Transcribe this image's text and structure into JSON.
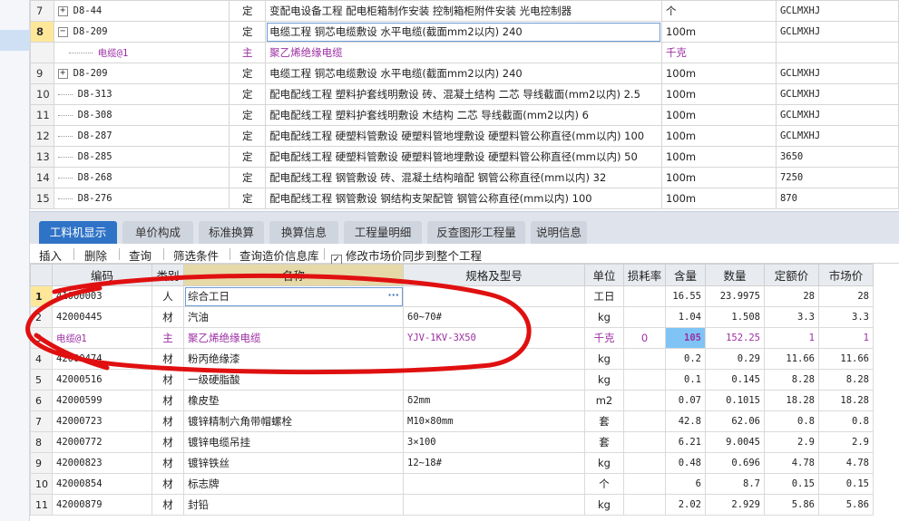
{
  "upper_rows": [
    {
      "rn": "7",
      "code": "D8-44",
      "expand": "+",
      "type": "定",
      "name": "变配电设备工程 配电柜箱制作安装 控制箱柜附件安装 光电控制器",
      "unit": "个",
      "spec": "",
      "extra": "GCLMXHJ"
    },
    {
      "rn": "8",
      "code": "D8-209",
      "expand": "−",
      "type": "定",
      "name": "电缆工程 铜芯电缆敷设 水平电缆(截面mm2以内) 240",
      "unit": "100m",
      "spec": "",
      "extra": "GCLMXHJ"
    },
    {
      "rn": "",
      "code": "电缆@1",
      "expand": "",
      "type": "主",
      "name": "聚乙烯绝缘电缆",
      "unit": "千克",
      "spec": "",
      "extra": ""
    },
    {
      "rn": "9",
      "code": "D8-209",
      "expand": "+",
      "type": "定",
      "name": "电缆工程 铜芯电缆敷设 水平电缆(截面mm2以内) 240",
      "unit": "100m",
      "spec": "",
      "extra": "GCLMXHJ"
    },
    {
      "rn": "10",
      "code": "D8-313",
      "expand": "",
      "type": "定",
      "name": "配电配线工程 塑料护套线明敷设 砖、混凝土结构 二芯 导线截面(mm2以内) 2.5",
      "unit": "100m",
      "spec": "",
      "extra": "GCLMXHJ"
    },
    {
      "rn": "11",
      "code": "D8-308",
      "expand": "",
      "type": "定",
      "name": "配电配线工程 塑料护套线明敷设 木结构 二芯 导线截面(mm2以内) 6",
      "unit": "100m",
      "spec": "",
      "extra": "GCLMXHJ"
    },
    {
      "rn": "12",
      "code": "D8-287",
      "expand": "",
      "type": "定",
      "name": "配电配线工程 硬塑料管敷设 硬塑料管地埋敷设 硬塑料管公称直径(mm以内) 100",
      "unit": "100m",
      "spec": "",
      "extra": "GCLMXHJ"
    },
    {
      "rn": "13",
      "code": "D8-285",
      "expand": "",
      "type": "定",
      "name": "配电配线工程 硬塑料管敷设 硬塑料管地埋敷设 硬塑料管公称直径(mm以内) 50",
      "unit": "100m",
      "spec": "",
      "extra": "3650"
    },
    {
      "rn": "14",
      "code": "D8-268",
      "expand": "",
      "type": "定",
      "name": "配电配线工程 钢管敷设 砖、混凝土结构暗配 钢管公称直径(mm以内) 32",
      "unit": "100m",
      "spec": "",
      "extra": "7250"
    },
    {
      "rn": "15",
      "code": "D8-276",
      "expand": "",
      "type": "定",
      "name": "配电配线工程 钢管敷设 钢结构支架配管 钢管公称直径(mm以内) 100",
      "unit": "100m",
      "spec": "",
      "extra": "870"
    }
  ],
  "tabs": [
    "工料机显示",
    "单价构成",
    "标准换算",
    "换算信息",
    "工程量明细",
    "反查图形工程量",
    "说明信息"
  ],
  "toolbar": {
    "insert": "插入",
    "delete": "删除",
    "query": "查询",
    "filter": "筛选条件",
    "query_price": "查询造价信息库",
    "sync_label": "修改市场价同步到整个工程",
    "sync_checked": "✓"
  },
  "lower_headers": [
    "",
    "编码",
    "类别",
    "名称",
    "规格及型号",
    "单位",
    "损耗率",
    "含量",
    "数量",
    "定额价",
    "市场价"
  ],
  "lower_rows": [
    {
      "rn": "1",
      "code": "41000003",
      "cat": "人",
      "name": "综合工日",
      "spec": "",
      "unit": "工日",
      "loss": "",
      "content": "16.55",
      "qty": "23.9975",
      "quota": "28",
      "market": "28"
    },
    {
      "rn": "2",
      "code": "42000445",
      "cat": "材",
      "name": "汽油",
      "spec": "60~70#",
      "unit": "kg",
      "loss": "",
      "content": "1.04",
      "qty": "1.508",
      "quota": "3.3",
      "market": "3.3"
    },
    {
      "rn": "3",
      "code": "电缆@1",
      "cat": "主",
      "name": "聚乙烯绝缘电缆",
      "spec": "YJV-1KV-3X50",
      "unit": "千克",
      "loss": "0",
      "content": "105",
      "qty": "152.25",
      "quota": "1",
      "market": "1"
    },
    {
      "rn": "4",
      "code": "42000474",
      "cat": "材",
      "name": "粉丙绝缘漆",
      "spec": "",
      "unit": "kg",
      "loss": "",
      "content": "0.2",
      "qty": "0.29",
      "quota": "11.66",
      "market": "11.66"
    },
    {
      "rn": "5",
      "code": "42000516",
      "cat": "材",
      "name": "一级硬脂酸",
      "spec": "",
      "unit": "kg",
      "loss": "",
      "content": "0.1",
      "qty": "0.145",
      "quota": "8.28",
      "market": "8.28"
    },
    {
      "rn": "6",
      "code": "42000599",
      "cat": "材",
      "name": "橡皮垫",
      "spec": "δ2mm",
      "unit": "m2",
      "loss": "",
      "content": "0.07",
      "qty": "0.1015",
      "quota": "18.28",
      "market": "18.28"
    },
    {
      "rn": "7",
      "code": "42000723",
      "cat": "材",
      "name": "镀锌精制六角带帽螺栓",
      "spec": "M10×80mm",
      "unit": "套",
      "loss": "",
      "content": "42.8",
      "qty": "62.06",
      "quota": "0.8",
      "market": "0.8"
    },
    {
      "rn": "8",
      "code": "42000772",
      "cat": "材",
      "name": "镀锌电缆吊挂",
      "spec": "3×100",
      "unit": "套",
      "loss": "",
      "content": "6.21",
      "qty": "9.0045",
      "quota": "2.9",
      "market": "2.9"
    },
    {
      "rn": "9",
      "code": "42000823",
      "cat": "材",
      "name": "镀锌铁丝",
      "spec": "12~18#",
      "unit": "kg",
      "loss": "",
      "content": "0.48",
      "qty": "0.696",
      "quota": "4.78",
      "market": "4.78"
    },
    {
      "rn": "10",
      "code": "42000854",
      "cat": "材",
      "name": "标志牌",
      "spec": "",
      "unit": "个",
      "loss": "",
      "content": "6",
      "qty": "8.7",
      "quota": "0.15",
      "market": "0.15"
    },
    {
      "rn": "11",
      "code": "42000879",
      "cat": "材",
      "name": "封铅",
      "spec": "",
      "unit": "kg",
      "loss": "",
      "content": "2.02",
      "qty": "2.929",
      "quota": "5.86",
      "market": "5.86"
    }
  ],
  "colors": {
    "accent": "#2f73c7",
    "purple": "#9c2fa3",
    "highlight": "#7fc4f5",
    "annotation": "#e01010"
  },
  "icons": {
    "expand": "plus-box-icon",
    "collapse": "minus-box-icon",
    "more": "ellipsis-icon",
    "checkbox": "checkbox-icon"
  }
}
